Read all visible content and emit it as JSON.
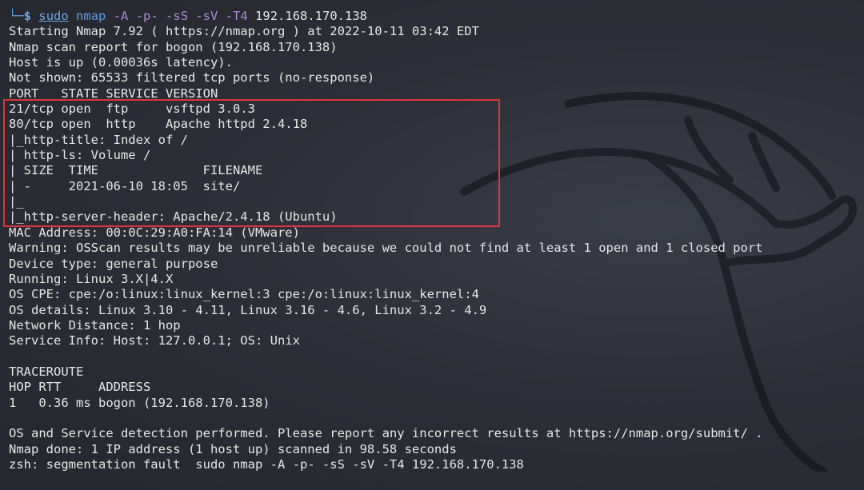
{
  "prompt": {
    "corner": "└─",
    "dollar": "$",
    "sudo": "sudo",
    "binary": "nmap",
    "flags": "-A -p- -sS -sV -T4",
    "target": "192.168.170.138"
  },
  "output_lines": [
    "Starting Nmap 7.92 ( https://nmap.org ) at 2022-10-11 03:42 EDT",
    "Nmap scan report for bogon (192.168.170.138)",
    "Host is up (0.00036s latency).",
    "Not shown: 65533 filtered tcp ports (no-response)",
    "PORT   STATE SERVICE VERSION",
    "21/tcp open  ftp     vsftpd 3.0.3",
    "80/tcp open  http    Apache httpd 2.4.18",
    "|_http-title: Index of /",
    "| http-ls: Volume /",
    "| SIZE  TIME              FILENAME",
    "| -     2021-06-10 18:05  site/",
    "|_",
    "|_http-server-header: Apache/2.4.18 (Ubuntu)",
    "MAC Address: 00:0C:29:A0:FA:14 (VMware)",
    "Warning: OSScan results may be unreliable because we could not find at least 1 open and 1 closed port",
    "Device type: general purpose",
    "Running: Linux 3.X|4.X",
    "OS CPE: cpe:/o:linux:linux_kernel:3 cpe:/o:linux:linux_kernel:4",
    "OS details: Linux 3.10 - 4.11, Linux 3.16 - 4.6, Linux 3.2 - 4.9",
    "Network Distance: 1 hop",
    "Service Info: Host: 127.0.0.1; OS: Unix",
    "",
    "TRACEROUTE",
    "HOP RTT     ADDRESS",
    "1   0.36 ms bogon (192.168.170.138)",
    "",
    "OS and Service detection performed. Please report any incorrect results at https://nmap.org/submit/ .",
    "Nmap done: 1 IP address (1 host up) scanned in 98.58 seconds",
    "zsh: segmentation fault  sudo nmap -A -p- -sS -sV -T4 192.168.170.138"
  ],
  "colors": {
    "background": "#2b2d35",
    "text": "#e6e6e6",
    "prompt": "#6aa8e8",
    "flag": "#a98ad6",
    "highlight_border": "#d9363e"
  },
  "icons": {
    "background": "kali-dragon-watermark"
  }
}
